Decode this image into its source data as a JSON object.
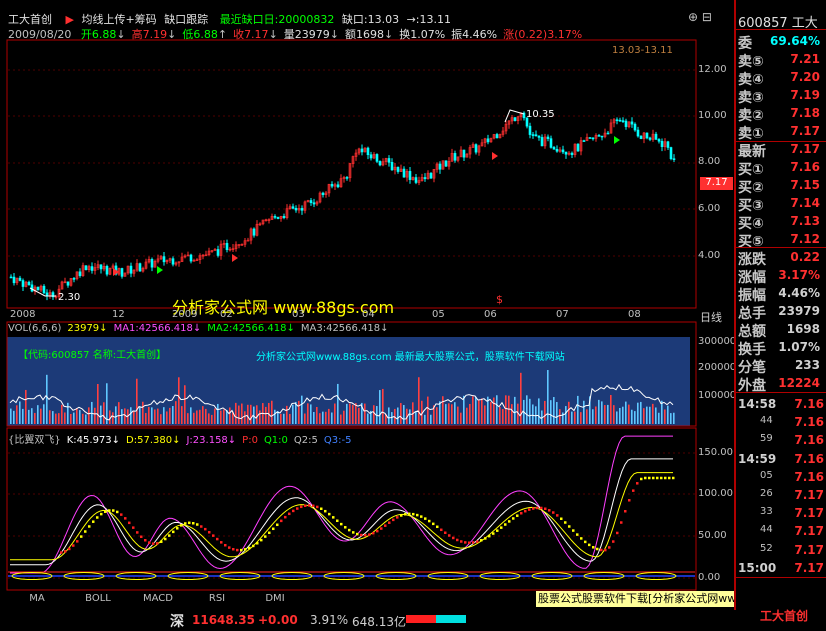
{
  "header": {
    "stock_name": "工大首创",
    "menu": [
      "均线上传+筹码",
      "缺口跟踪",
      "最近缺口日:20000832",
      "缺口:13.03",
      "→:13.11"
    ],
    "date": "2009/08/20",
    "quote_items": [
      {
        "label": "开",
        "value": "6.88",
        "arrow": "↓"
      },
      {
        "label": "高",
        "value": "7.19",
        "arrow": "↓"
      },
      {
        "label": "低",
        "value": "6.88",
        "arrow": "↑"
      },
      {
        "label": "收",
        "value": "7.17",
        "arrow": "↓"
      },
      {
        "label": "量",
        "value": "23979",
        "arrow": "↓"
      },
      {
        "label": "额",
        "value": "1698",
        "arrow": "↓"
      },
      {
        "label": "换",
        "value": "1.07%",
        "arrow": ""
      },
      {
        "label": "振",
        "value": "4.46%",
        "arrow": ""
      },
      {
        "label": "涨",
        "value": "(0.22)3.17%",
        "arrow": ""
      }
    ]
  },
  "price_chart": {
    "y_ticks": [
      "12.00",
      "10.00",
      "8.00",
      "6.00",
      "4.00"
    ],
    "x_ticks": [
      "2008",
      "12",
      "2009",
      "02",
      "03",
      "04",
      "05",
      "06",
      "07",
      "08"
    ],
    "gap_label": "13.03-13.11",
    "high_label": "10.35",
    "low_label": "2.30",
    "current_price_tag": "7.17",
    "watermark": "分析家公式网 www.88gs.com",
    "scale_mode": "日线"
  },
  "volume_chart": {
    "legend": [
      {
        "text": "VOL(6,6,6)",
        "color": "#c0c0c0"
      },
      {
        "text": "23979↓",
        "color": "#ffff00"
      },
      {
        "text": "MA1:42566.418↓",
        "color": "#ff50ff"
      },
      {
        "text": "MA2:42566.418↓",
        "color": "#00ff00"
      },
      {
        "text": "MA3:42566.418↓",
        "color": "#c0c0c0"
      }
    ],
    "info_code": "【代码:600857 名称:工大首创】",
    "info_site": "分析家公式网www.88gs.com 最新最大股票公式，股票软件下载网站",
    "y_ticks": [
      "300000",
      "200000",
      "100000"
    ]
  },
  "indicator_chart": {
    "legend": [
      {
        "text": "{比翼双飞}",
        "color": "#c0c0c0"
      },
      {
        "text": "K:45.973↓",
        "color": "#ffffff"
      },
      {
        "text": "D:57.380↓",
        "color": "#ffff00"
      },
      {
        "text": "J:23.158↓",
        "color": "#ff50ff"
      },
      {
        "text": "P:0",
        "color": "#ff3030"
      },
      {
        "text": "Q1:0",
        "color": "#00ff00"
      },
      {
        "text": "Q2:5",
        "color": "#c0c0c0"
      },
      {
        "text": "Q3:-5",
        "color": "#4080ff"
      }
    ],
    "y_ticks": [
      "150.00",
      "100.00",
      "50.00",
      "0.00"
    ]
  },
  "tabs": [
    "MA",
    "BOLL",
    "MACD",
    "RSI",
    "DMI"
  ],
  "footer_banner": "股票公式股票软件下载[分析家公式网www.88gs.com]",
  "status_bar": {
    "market": "深",
    "index": "11648.35",
    "change": "+0.00",
    "pct": "3.91%",
    "amount": "648.13亿"
  },
  "side_panel": {
    "code": "600857",
    "name": "工大",
    "wei_label": "委",
    "wei_value": "69.64%",
    "sell": [
      {
        "label": "卖⑤",
        "value": "7.21"
      },
      {
        "label": "卖④",
        "value": "7.20"
      },
      {
        "label": "卖③",
        "value": "7.19"
      },
      {
        "label": "卖②",
        "value": "7.18"
      },
      {
        "label": "卖①",
        "value": "7.17"
      }
    ],
    "latest": {
      "label": "最新",
      "value": "7.17"
    },
    "buy": [
      {
        "label": "买①",
        "value": "7.16"
      },
      {
        "label": "买②",
        "value": "7.15"
      },
      {
        "label": "买③",
        "value": "7.14"
      },
      {
        "label": "买④",
        "value": "7.13"
      },
      {
        "label": "买⑤",
        "value": "7.12"
      }
    ],
    "stats": [
      {
        "label": "涨跌",
        "value": "0.22",
        "color": "#ff3030"
      },
      {
        "label": "涨幅",
        "value": "3.17%",
        "color": "#ff3030"
      },
      {
        "label": "振幅",
        "value": "4.46%",
        "color": "#d0d0d0"
      },
      {
        "label": "总手",
        "value": "23979",
        "color": "#d0d0d0"
      },
      {
        "label": "总额",
        "value": "1698",
        "color": "#d0d0d0"
      },
      {
        "label": "换手",
        "value": "1.07%",
        "color": "#d0d0d0"
      },
      {
        "label": "分笔",
        "value": "233",
        "color": "#d0d0d0"
      },
      {
        "label": "外盘",
        "value": "12224",
        "color": "#ff3030"
      }
    ],
    "ticks": [
      {
        "time": "14:58",
        "price": "7.16"
      },
      {
        "time": "44",
        "price": "7.16"
      },
      {
        "time": "59",
        "price": "7.16"
      },
      {
        "time": "14:59",
        "price": "7.16"
      },
      {
        "time": "05",
        "price": "7.16"
      },
      {
        "time": "26",
        "price": "7.17"
      },
      {
        "time": "33",
        "price": "7.17"
      },
      {
        "time": "44",
        "price": "7.17"
      },
      {
        "time": "52",
        "price": "7.17"
      },
      {
        "time": "15:00",
        "price": "7.17"
      }
    ],
    "bottom_name": "工大首创"
  },
  "colors": {
    "up": "#ff3030",
    "down": "#00ffff",
    "axis": "#b00000",
    "vol_bg": "#1c3a78",
    "accent_yellow": "#ffff00"
  }
}
